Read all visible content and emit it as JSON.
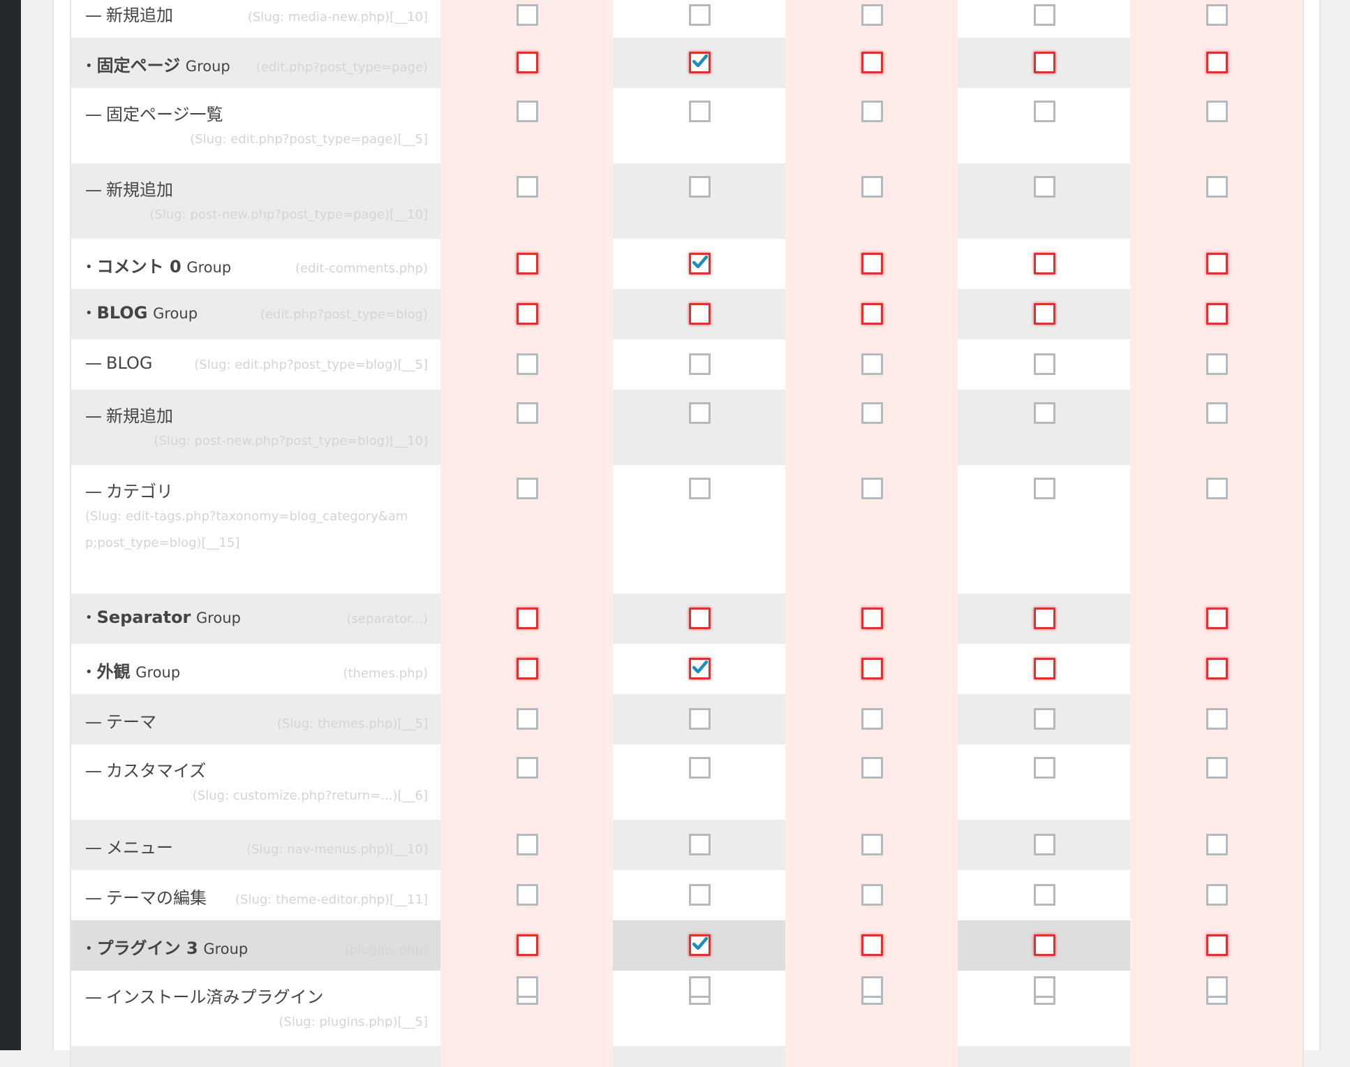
{
  "colors": {
    "sidebar": "#23282d",
    "pink_column": "#ffebe8",
    "row_gray": "#ececec",
    "row_hover": "#dedede",
    "checkbox_group_border": "#dc3232",
    "checkbox_item_border": "#b4b9be",
    "checkmark": "#1e8cbe"
  },
  "group_word": "Group",
  "rows": [
    {
      "type": "item",
      "prefix": "—",
      "label": "新規追加",
      "slug": "(Slug: media-new.php)[__10]",
      "slug_pos": "inline",
      "checks": [
        false,
        false,
        false,
        false,
        false
      ]
    },
    {
      "type": "group",
      "prefix": "•",
      "label": "固定ページ",
      "slug": "(edit.php?post_type=page)",
      "slug_pos": "inline",
      "checks": [
        false,
        true,
        false,
        false,
        false
      ]
    },
    {
      "type": "item",
      "prefix": "—",
      "label": "固定ページ一覧",
      "slug": "(Slug: edit.php?post_type=page)[__5]",
      "slug_pos": "below",
      "checks": [
        false,
        false,
        false,
        false,
        false
      ]
    },
    {
      "type": "item",
      "prefix": "—",
      "label": "新規追加",
      "slug": "(Slug: post-new.php?post_type=page)[__10]",
      "slug_pos": "below",
      "checks": [
        false,
        false,
        false,
        false,
        false
      ]
    },
    {
      "type": "group",
      "prefix": "•",
      "label": "コメント 0",
      "slug": "(edit-comments.php)",
      "slug_pos": "inline",
      "checks": [
        false,
        true,
        false,
        false,
        false
      ]
    },
    {
      "type": "group",
      "prefix": "•",
      "label": "BLOG",
      "slug": "(edit.php?post_type=blog)",
      "slug_pos": "inline",
      "checks": [
        false,
        false,
        false,
        false,
        false
      ]
    },
    {
      "type": "item",
      "prefix": "—",
      "label": "BLOG",
      "slug": "(Slug: edit.php?post_type=blog)[__5]",
      "slug_pos": "inline",
      "checks": [
        false,
        false,
        false,
        false,
        false
      ]
    },
    {
      "type": "item",
      "prefix": "—",
      "label": "新規追加",
      "slug": "(Slug: post-new.php?post_type=blog)[__10]",
      "slug_pos": "below",
      "checks": [
        false,
        false,
        false,
        false,
        false
      ]
    },
    {
      "type": "item",
      "prefix": "—",
      "label": "カテゴリ",
      "slug": "(Slug: edit-tags.php?taxonomy=blog_category&amp;post_type=blog)[__15]",
      "slug_pos": "wrap",
      "checks": [
        false,
        false,
        false,
        false,
        false
      ]
    },
    {
      "type": "group",
      "prefix": "•",
      "label": "Separator",
      "slug": "(separator...)",
      "slug_pos": "inline",
      "checks": [
        false,
        false,
        false,
        false,
        false
      ]
    },
    {
      "type": "group",
      "prefix": "•",
      "label": "外観",
      "slug": "(themes.php)",
      "slug_pos": "inline",
      "checks": [
        false,
        true,
        false,
        false,
        false
      ]
    },
    {
      "type": "item",
      "prefix": "—",
      "label": "テーマ",
      "slug": "(Slug: themes.php)[__5]",
      "slug_pos": "inline",
      "checks": [
        false,
        false,
        false,
        false,
        false
      ]
    },
    {
      "type": "item",
      "prefix": "—",
      "label": "カスタマイズ",
      "slug": "(Slug: customize.php?return=...)[__6]",
      "slug_pos": "below",
      "checks": [
        false,
        false,
        false,
        false,
        false
      ]
    },
    {
      "type": "item",
      "prefix": "—",
      "label": "メニュー",
      "slug": "(Slug: nav-menus.php)[__10]",
      "slug_pos": "inline",
      "checks": [
        false,
        false,
        false,
        false,
        false
      ]
    },
    {
      "type": "item",
      "prefix": "—",
      "label": "テーマの編集",
      "slug": "(Slug: theme-editor.php)[__11]",
      "slug_pos": "inline",
      "checks": [
        false,
        false,
        false,
        false,
        false
      ]
    },
    {
      "type": "group",
      "prefix": "•",
      "label": "プラグイン 3",
      "slug": "(plugins.php)",
      "slug_pos": "inline",
      "checks": [
        false,
        true,
        false,
        false,
        false
      ],
      "hover": true
    },
    {
      "type": "item",
      "prefix": "—",
      "label": "インストール済みプラグイン",
      "slug": "(Slug: plugins.php)[__5]",
      "slug_pos": "below",
      "checks": [
        false,
        false,
        false,
        false,
        false
      ]
    },
    {
      "type": "item",
      "prefix": "",
      "label": "",
      "slug": "",
      "slug_pos": "inline",
      "checks": [
        false,
        false,
        false,
        false,
        false
      ],
      "partial": true
    }
  ]
}
